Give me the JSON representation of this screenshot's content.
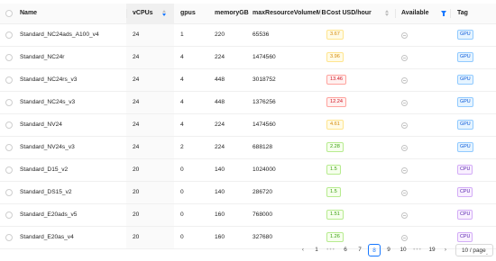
{
  "table": {
    "columns": [
      "Name",
      "vCPUs",
      "gpus",
      "memoryGB",
      "maxResourceVolumeMB",
      "Cost USD/hour",
      "Available",
      "Tag"
    ],
    "rows": [
      {
        "name": "Standard_NC24ads_A100_v4",
        "vcpus": "24",
        "gpus": "1",
        "memory": "220",
        "maxres": "65536",
        "cost": "3.67",
        "cost_color": "yellow",
        "tag": "GPU"
      },
      {
        "name": "Standard_NC24r",
        "vcpus": "24",
        "gpus": "4",
        "memory": "224",
        "maxres": "1474560",
        "cost": "3.96",
        "cost_color": "yellow",
        "tag": "GPU"
      },
      {
        "name": "Standard_NC24rs_v3",
        "vcpus": "24",
        "gpus": "4",
        "memory": "448",
        "maxres": "3018752",
        "cost": "13.46",
        "cost_color": "red",
        "tag": "GPU"
      },
      {
        "name": "Standard_NC24s_v3",
        "vcpus": "24",
        "gpus": "4",
        "memory": "448",
        "maxres": "1376256",
        "cost": "12.24",
        "cost_color": "red",
        "tag": "GPU"
      },
      {
        "name": "Standard_NV24",
        "vcpus": "24",
        "gpus": "4",
        "memory": "224",
        "maxres": "1474560",
        "cost": "4.61",
        "cost_color": "yellow",
        "tag": "GPU"
      },
      {
        "name": "Standard_NV24s_v3",
        "vcpus": "24",
        "gpus": "2",
        "memory": "224",
        "maxres": "688128",
        "cost": "2.28",
        "cost_color": "green",
        "tag": "GPU"
      },
      {
        "name": "Standard_D15_v2",
        "vcpus": "20",
        "gpus": "0",
        "memory": "140",
        "maxres": "1024000",
        "cost": "1.5",
        "cost_color": "green",
        "tag": "CPU"
      },
      {
        "name": "Standard_DS15_v2",
        "vcpus": "20",
        "gpus": "0",
        "memory": "140",
        "maxres": "286720",
        "cost": "1.5",
        "cost_color": "green",
        "tag": "CPU"
      },
      {
        "name": "Standard_E20ads_v5",
        "vcpus": "20",
        "gpus": "0",
        "memory": "160",
        "maxres": "768000",
        "cost": "1.51",
        "cost_color": "green",
        "tag": "CPU"
      },
      {
        "name": "Standard_E20as_v4",
        "vcpus": "20",
        "gpus": "0",
        "memory": "160",
        "maxres": "327680",
        "cost": "1.26",
        "cost_color": "green",
        "tag": "CPU"
      }
    ],
    "sort": {
      "column": "vCPUs",
      "direction": "descending"
    },
    "available_filter_active": true
  },
  "pagination": {
    "prev_icon": "chevron-left-icon",
    "next_icon": "chevron-right-icon",
    "items": [
      "1",
      "•••",
      "6",
      "7",
      "8",
      "9",
      "10",
      "•••",
      "19"
    ],
    "current": "8",
    "page_size": "10 / page"
  },
  "colors": {
    "accent": "#1677ff"
  }
}
